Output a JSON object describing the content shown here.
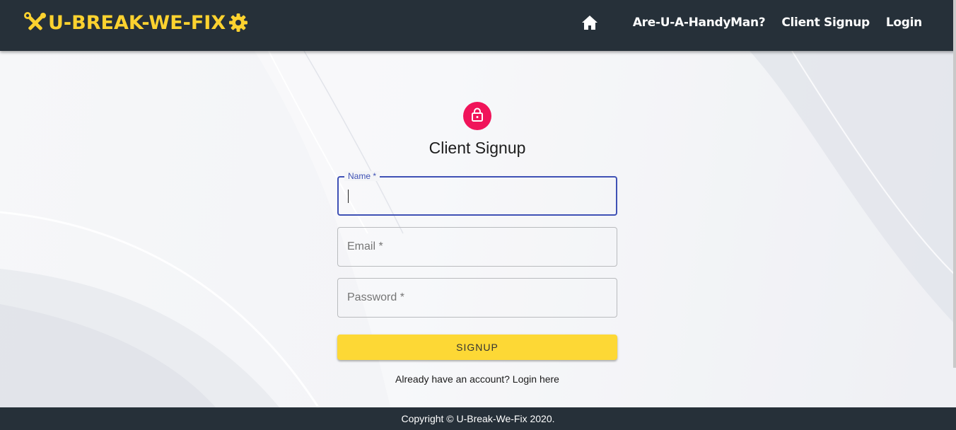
{
  "navbar": {
    "brand": "U-BREAK-WE-FIX",
    "links": [
      "Are-U-A-HandyMan?",
      "Client Signup",
      "Login"
    ]
  },
  "form": {
    "title": "Client Signup",
    "name_label": "Name *",
    "email_placeholder": "Email *",
    "password_placeholder": "Password *",
    "submit_label": "SIGNUP",
    "login_prompt": "Already have an account? Login here"
  },
  "footer": {
    "copyright": "Copyright © U-Break-We-Fix 2020."
  },
  "icons": {
    "brand_left": "tools-icon",
    "brand_right": "gear-icon",
    "home": "home-icon",
    "lock": "lock-icon"
  },
  "colors": {
    "navbar_bg": "#263039",
    "brand": "#fcd22f",
    "avatar": "#f0145a",
    "focus": "#3f51b5",
    "button": "#fdd835"
  }
}
